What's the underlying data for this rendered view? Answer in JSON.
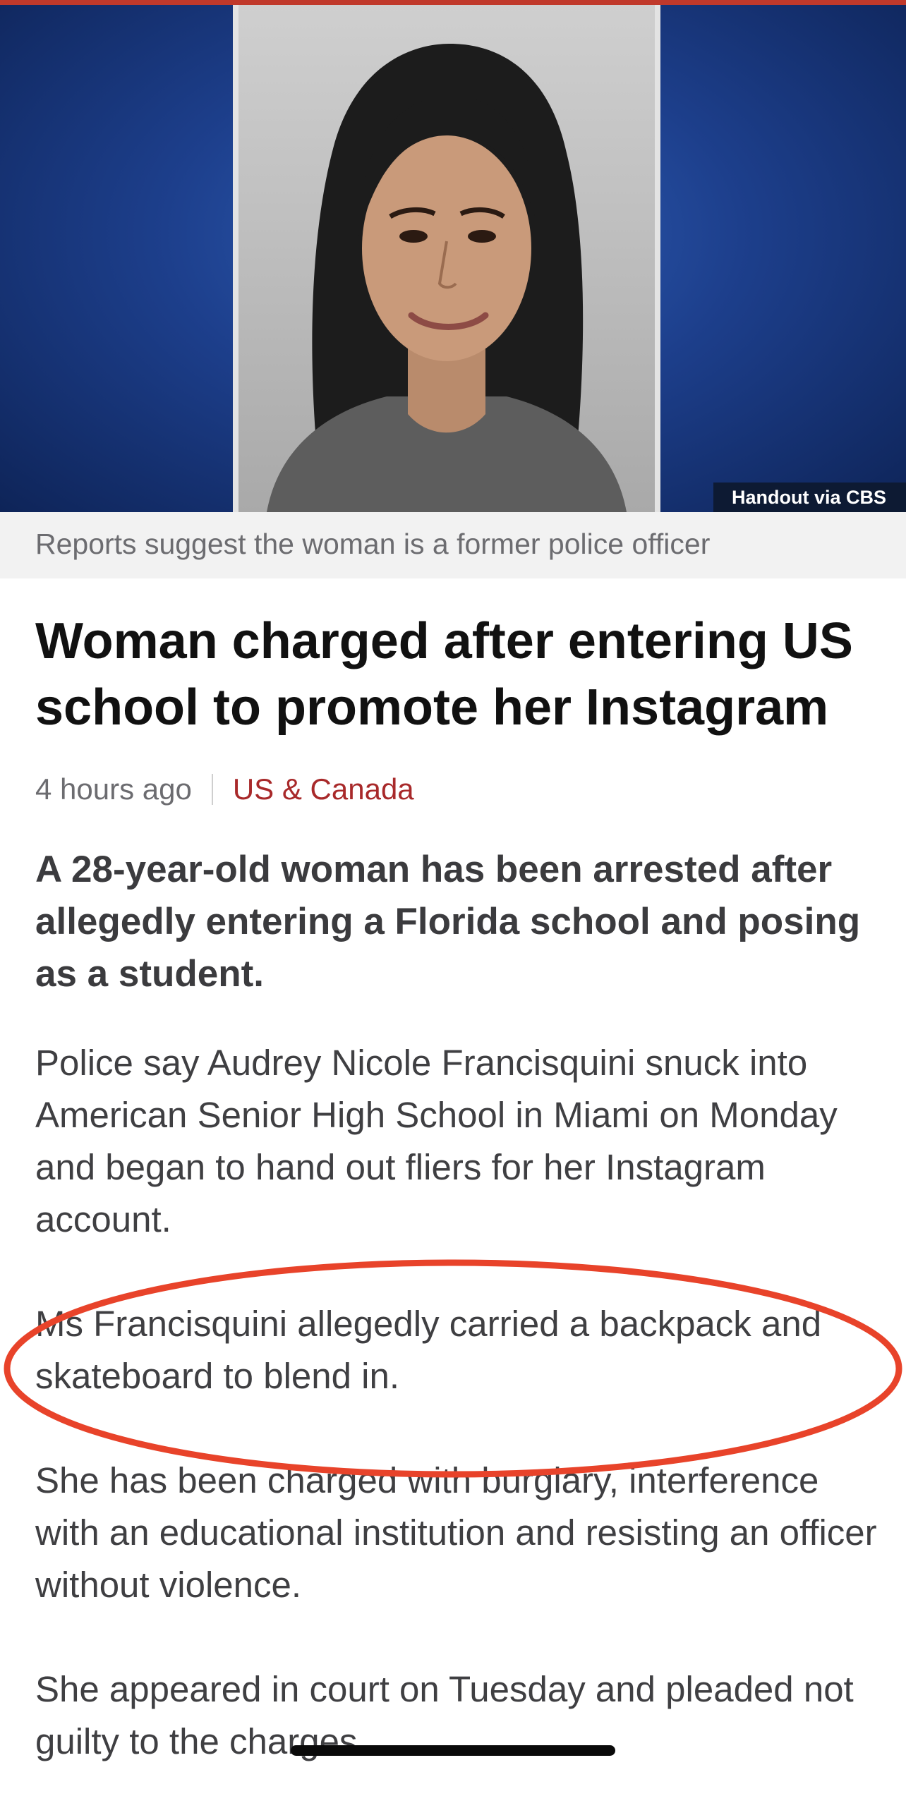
{
  "hero": {
    "photo_credit": "Handout via CBS",
    "caption": "Reports suggest the woman is a former police officer"
  },
  "article": {
    "headline": "Woman charged after entering US school to promote her Instagram",
    "timestamp": "4 hours ago",
    "section": "US & Canada",
    "lede": "A 28-year-old woman has been arrested after allegedly entering a Florida school and posing as a student.",
    "paragraphs": [
      "Police say Audrey Nicole Francisquini snuck into American Senior High School in Miami on Monday and began to hand out fliers for her Instagram account.",
      "Ms Francisquini allegedly carried a backpack and skateboard to blend in.",
      "She has been charged with burglary, interference with an educational institution and resisting an officer without violence.",
      "She appeared in court on Tuesday and pleaded not guilty to the charges."
    ]
  },
  "colors": {
    "accent_red": "#c0392b",
    "section_red": "#a8292a",
    "highlight_ellipse": "#e8432a"
  }
}
